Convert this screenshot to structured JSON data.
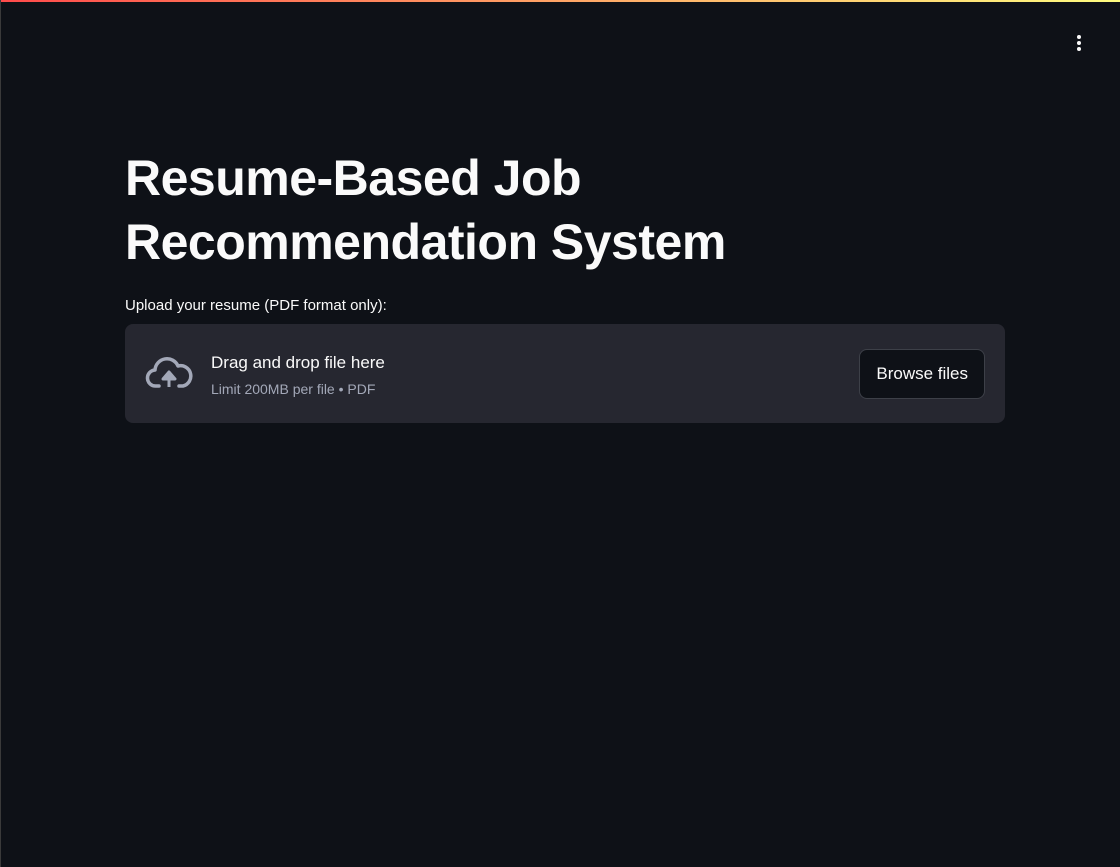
{
  "header": {
    "menu_icon": "vertical-ellipsis-icon"
  },
  "main": {
    "title": "Resume-Based Job Recommendation System",
    "uploader": {
      "label": "Upload your resume (PDF format only):",
      "icon": "cloud-upload-icon",
      "instruction": "Drag and drop file here",
      "limit": "Limit 200MB per file • PDF",
      "button": "Browse files"
    }
  },
  "colors": {
    "background": "#0e1117",
    "uploader_bg": "#262730",
    "accent_start": "#ff4b4b",
    "accent_end": "#fffd80"
  }
}
